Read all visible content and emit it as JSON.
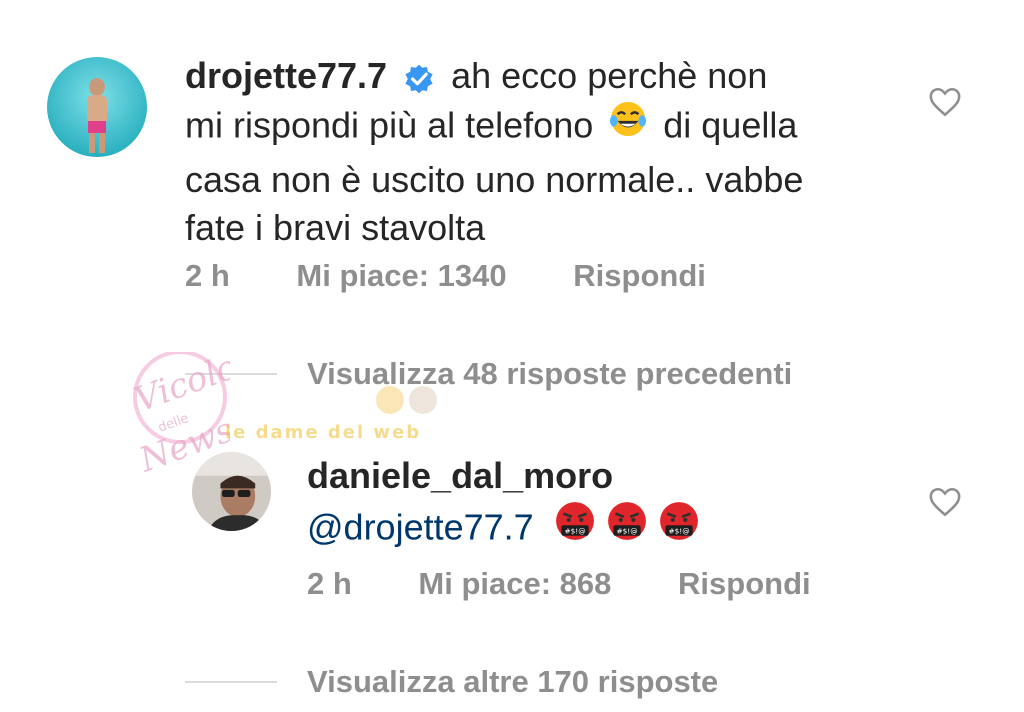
{
  "comment1": {
    "username": "drojette77.7",
    "verified": true,
    "text_1": "ah ecco perchè non",
    "text_2": "mi rispondi più al telefono",
    "text_2_emoji": "face-with-tears-of-joy",
    "text_3": "di quella",
    "text_4": "casa non è uscito uno normale.. vabbe",
    "text_5": "fate i bravi stavolta",
    "time": "2 h",
    "likes": "Mi piace: 1340",
    "reply": "Rispondi"
  },
  "view_previous": "Visualizza 48 risposte precedenti",
  "comment2": {
    "username": "daniele_dal_moro",
    "mention": "@drojette77.7",
    "emojis": [
      "face-with-symbols-on-mouth",
      "face-with-symbols-on-mouth",
      "face-with-symbols-on-mouth"
    ],
    "emoji_text": "#$!@",
    "time": "2 h",
    "likes": "Mi piace: 868",
    "reply": "Rispondi"
  },
  "view_more": "Visualizza altre 170 risposte",
  "watermark": {
    "text_1": "Vicolo",
    "text_2": "delle",
    "text_3": "News",
    "text_4": "le dame del web"
  },
  "colors": {
    "text": "#262626",
    "secondary": "#8e8e8e",
    "verified": "#3897f0",
    "mention": "#00376b",
    "angry": "#e0262b"
  }
}
